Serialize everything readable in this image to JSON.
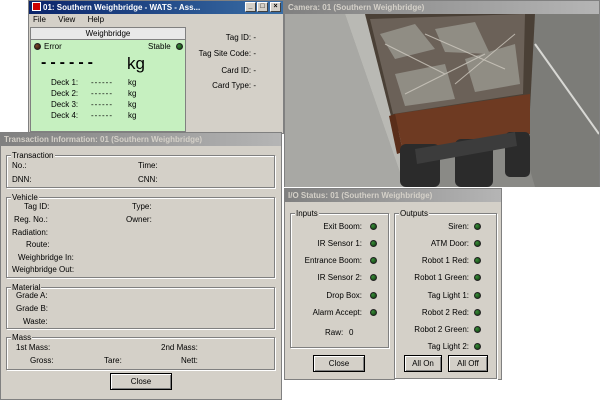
{
  "main_window": {
    "title": "01: Southern Weighbridge - WATS - Ass...",
    "menu": [
      "File",
      "View",
      "Help"
    ],
    "weighbridge": {
      "title": "Weighbridge",
      "error_label": "Error",
      "stable_label": "Stable",
      "weight_value": "------",
      "weight_unit": "kg",
      "decks": [
        {
          "label": "Deck 1:",
          "value": "------",
          "unit": "kg"
        },
        {
          "label": "Deck 2:",
          "value": "------",
          "unit": "kg"
        },
        {
          "label": "Deck 3:",
          "value": "------",
          "unit": "kg"
        },
        {
          "label": "Deck 4:",
          "value": "------",
          "unit": "kg"
        }
      ]
    },
    "tag_info": {
      "tag_id": "Tag ID: -",
      "tag_site_code": "Tag Site Code: -",
      "card_id": "Card ID: -",
      "card_type": "Card Type: -"
    }
  },
  "camera_window": {
    "title": "Camera: 01 (Southern Weighbridge)"
  },
  "transaction_window": {
    "title": "Transaction Information: 01 (Southern Weighbridge)",
    "transaction": {
      "legend": "Transaction",
      "no": "No.:",
      "time": "Time:",
      "dnn": "DNN:",
      "cnn": "CNN:"
    },
    "vehicle": {
      "legend": "Vehicle",
      "tag_id": "Tag ID:",
      "type": "Type:",
      "reg_no": "Reg. No.:",
      "owner": "Owner:",
      "radiation": "Radiation:",
      "route": "Route:",
      "weighbridge_in": "Weighbridge In:",
      "weighbridge_out": "Weighbridge Out:"
    },
    "material": {
      "legend": "Material",
      "grade_a": "Grade A:",
      "grade_b": "Grade B:",
      "waste": "Waste:"
    },
    "mass": {
      "legend": "Mass",
      "first_mass": "1st Mass:",
      "second_mass": "2nd Mass:",
      "gross": "Gross:",
      "tare": "Tare:",
      "nett": "Nett:"
    },
    "close_label": "Close"
  },
  "io_window": {
    "title": "I/O Status: 01 (Southern Weighbridge)",
    "inputs_legend": "Inputs",
    "outputs_legend": "Outputs",
    "inputs": [
      "Exit Boom:",
      "IR Sensor 1:",
      "Entrance Boom:",
      "IR Sensor 2:",
      "Drop Box:",
      "Alarm Accept:"
    ],
    "raw_label": "Raw:",
    "raw_value": "0",
    "outputs": [
      "Siren:",
      "ATM Door:",
      "Robot 1 Red:",
      "Robot 1 Green:",
      "Tag Light 1:",
      "Robot 2 Red:",
      "Robot 2 Green:",
      "Tag Light 2:"
    ],
    "close_label": "Close",
    "all_on_label": "All On",
    "all_off_label": "All Off"
  },
  "colors": {
    "active_title": "#0a246a",
    "inactive_title": "#808080",
    "weighbridge_bg": "#c6f0c0",
    "led_green": "#1f5a1f"
  }
}
